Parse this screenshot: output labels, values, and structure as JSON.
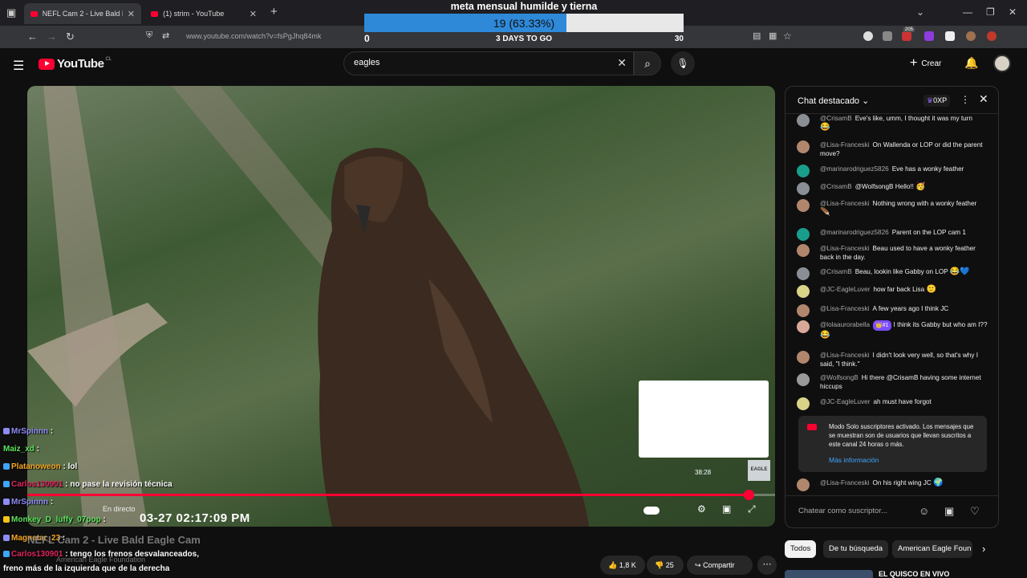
{
  "browser": {
    "tabs": [
      {
        "label": "NEFL Cam 2 - Live Bald Eag",
        "active": true
      },
      {
        "label": "(1) strim - YouTube",
        "active": false
      }
    ],
    "new_tab": "+",
    "url": "www.youtube.com/watch?v=fsPgJhq84mk",
    "ext_badge": "205"
  },
  "goal": {
    "title": "meta mensual humilde y tierna",
    "value_label": "19 (63.33%)",
    "progress": 0.6333,
    "min": "0",
    "max": "30",
    "days_left": "3 DAYS TO GO"
  },
  "header": {
    "logo_text": "YouTube",
    "country": "CL",
    "search_value": "eagles",
    "create_label": "Crear"
  },
  "video": {
    "title": "NEFL Cam 2 - Live Bald Eagle Cam",
    "channel": "American Eagle Foundation",
    "live_label": "En directo",
    "timestamp": "03-27 02:17:09 PM",
    "hover_time": "38:28",
    "watermark": "EAGLE",
    "progress": 0.965,
    "likes": "1,8 K",
    "dislikes": "25",
    "share_label": "Compartir"
  },
  "stream_overlay_chat": [
    {
      "user": "MrSpinnn",
      "user_color": "#8e8cf5",
      "text": ":",
      "badge_color": "#8e8cf5"
    },
    {
      "user": "Maiz_xd",
      "user_color": "#5ee35e",
      "text": ":",
      "badge_color": ""
    },
    {
      "user": "Platanoweon",
      "user_color": "#f5a623",
      "text": ": lol",
      "badge_color": "#3ea6ff"
    },
    {
      "user": "Carlos130901",
      "user_color": "#e0245e",
      "text": ": no pase la revisión técnica",
      "badge_color": "#3ea6ff"
    },
    {
      "user": "MrSpinnn",
      "user_color": "#8e8cf5",
      "text": ":",
      "badge_color": "#8e8cf5"
    },
    {
      "user": "Monkey_D_luffy_07pop",
      "user_color": "#5ee35e",
      "text": ":",
      "badge_color": "#f5c518"
    },
    {
      "user": "Magnetar_23",
      "user_color": "#f5a623",
      "text": ":",
      "badge_color": "#8e8cf5"
    },
    {
      "user": "Carlos130901",
      "user_color": "#e0245e",
      "text": ": tengo los frenos desvalanceados,",
      "badge_color": "#3ea6ff"
    },
    {
      "user": "",
      "user_color": "#fff",
      "text": "freno más de la izquierda que de la derecha",
      "badge_color": ""
    }
  ],
  "chat": {
    "title": "Chat destacado",
    "xp": "0XP",
    "messages": [
      {
        "author": "@CrisamB",
        "text": "Eve's like, umm, I thought it was my turn",
        "emoji": "😂",
        "avatar_color": "#8a8f96"
      },
      {
        "author": "@Lisa-Franceski",
        "text": "On Wallenda or LOP or did the parent move?",
        "emoji": "",
        "avatar_color": "#b0876d"
      },
      {
        "author": "@marinarodriguez5826",
        "text": "Eve has a wonky feather",
        "emoji": "",
        "avatar_color": "#1a9e8c"
      },
      {
        "author": "@CrisamB",
        "text": "@WolfsongB Hello!!",
        "emoji": "🥳",
        "avatar_color": "#8a8f96"
      },
      {
        "author": "@Lisa-Franceski",
        "text": "Nothing wrong with a wonky feather",
        "emoji": "🪶",
        "avatar_color": "#b0876d"
      },
      {
        "author": "@marinarodriguez5826",
        "text": "Parent on the LOP cam 1",
        "emoji": "",
        "avatar_color": "#1a9e8c"
      },
      {
        "author": "@Lisa-Franceski",
        "text": "Beau used to have a wonky feather back in the day.",
        "emoji": "",
        "avatar_color": "#b0876d"
      },
      {
        "author": "@CrisamB",
        "text": "Beau, lookin like Gabby on LOP",
        "emoji": "😂💙",
        "avatar_color": "#8a8f96"
      },
      {
        "author": "@JC-EagleLuver",
        "text": "how far back Lisa",
        "emoji": "🙂",
        "avatar_color": "#d9d38a"
      },
      {
        "author": "@Lisa-Franceski",
        "text": "A few years ago I think JC",
        "emoji": "",
        "avatar_color": "#b0876d"
      },
      {
        "author": "@lolaaurorabella",
        "badge": "👑#1",
        "text": "I think its Gabby but who am I??",
        "emoji": "😂",
        "avatar_color": "#d8a898"
      },
      {
        "author": "@Lisa-Franceski",
        "text": "I didn't look very well, so that's why I said, \"I think.\"",
        "emoji": "",
        "avatar_color": "#b0876d"
      },
      {
        "author": "@WolfsongB",
        "text": "Hi there @CrisamB having some internet hiccups",
        "emoji": "",
        "avatar_color": "#9a9a9a"
      },
      {
        "author": "@JC-EagleLuver",
        "text": "ah must have forgot",
        "emoji": "",
        "avatar_color": "#d9d38a"
      },
      {
        "author": "@Lisa-Franceski",
        "text": "On his right wing JC",
        "emoji": "🌍",
        "avatar_color": "#b0876d"
      }
    ],
    "notice_text": "Modo Solo suscriptores activado. Los mensajes que se muestran son de usuarios que llevan suscritos a este canal 24 horas o más.",
    "notice_link": "Más información",
    "input_placeholder": "Chatear como suscriptor..."
  },
  "chips": [
    "Todos",
    "De tu búsqueda",
    "American Eagle Foun"
  ],
  "recommended": {
    "title": "EL QUISCO EN VIVO"
  },
  "colors": {
    "accent": "#ff0033",
    "goal_fill": "#2e89d9",
    "link": "#3ea6ff"
  }
}
